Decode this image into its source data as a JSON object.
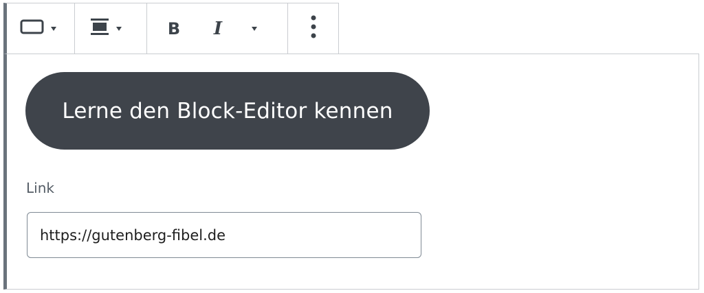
{
  "toolbar": {
    "style_icon": "button-style-icon",
    "align_icon": "align-center-icon",
    "bold_label": "B",
    "italic_label": "I",
    "more_icon": "more-vertical-icon"
  },
  "button_block": {
    "text": "Lerne den Block-Editor kennen"
  },
  "link_field": {
    "label": "Link",
    "value": "https://gutenberg-fibel.de"
  },
  "colors": {
    "button_bg": "#3f444b",
    "button_text": "#ffffff",
    "border": "#c9ccd0",
    "accent_left": "#6a737c"
  }
}
